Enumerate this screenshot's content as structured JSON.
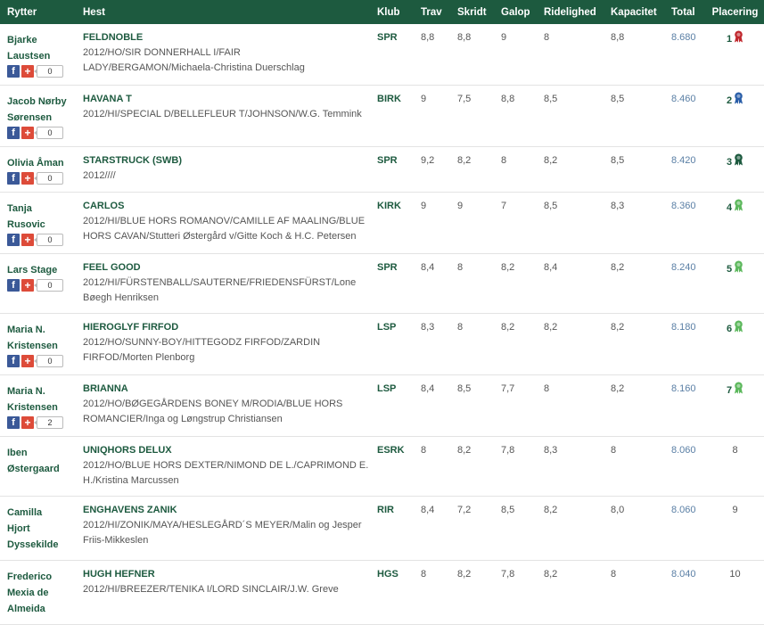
{
  "headers": {
    "rytter": "Rytter",
    "hest": "Hest",
    "klub": "Klub",
    "trav": "Trav",
    "skridt": "Skridt",
    "galop": "Galop",
    "ridelighed": "Ridelighed",
    "kapacitet": "Kapacitet",
    "total": "Total",
    "placering": "Placering"
  },
  "colors": {
    "header_bg": "#1d5a3f",
    "accent_text": "#1d5a3f",
    "total_text": "#5a7fa5",
    "facebook": "#3b5998",
    "google_plus": "#dd4b39",
    "rosette_red": "#c0272d",
    "rosette_blue": "#2a5ea8",
    "rosette_darkgreen": "#1d5a3f",
    "rosette_green": "#5cb85c"
  },
  "share_icons": {
    "facebook": "f",
    "google_plus": "+"
  },
  "rows": [
    {
      "rider_line1": "Bjarke",
      "rider_line2": "Laustsen",
      "rider_line3": "",
      "share_count": "0",
      "horse": "FELDNOBLE",
      "pedigree": "2012/HO/SIR DONNERHALL I/FAIR LADY/BERGAMON/Michaela-Christina Duerschlag",
      "klub": "SPR",
      "trav": "8,8",
      "skridt": "8,8",
      "galop": "9",
      "ridelighed": "8",
      "kapacitet": "8,8",
      "total": "8.680",
      "placering": "1",
      "rosette": "rosette_red"
    },
    {
      "rider_line1": "Jacob Nørby",
      "rider_line2": "Sørensen",
      "rider_line3": "",
      "share_count": "0",
      "horse": "HAVANA T",
      "pedigree": "2012/HI/SPECIAL D/BELLEFLEUR T/JOHNSON/W.G. Temmink",
      "klub": "BIRK",
      "trav": "9",
      "skridt": "7,5",
      "galop": "8,8",
      "ridelighed": "8,5",
      "kapacitet": "8,5",
      "total": "8.460",
      "placering": "2",
      "rosette": "rosette_blue"
    },
    {
      "rider_line1": "Olivia Åman",
      "rider_line2": "",
      "rider_line3": "",
      "share_count": "0",
      "horse": "STARSTRUCK (SWB)",
      "pedigree": "2012////",
      "klub": "SPR",
      "trav": "9,2",
      "skridt": "8,2",
      "galop": "8",
      "ridelighed": "8,2",
      "kapacitet": "8,5",
      "total": "8.420",
      "placering": "3",
      "rosette": "rosette_darkgreen"
    },
    {
      "rider_line1": "Tanja",
      "rider_line2": "Rusovic",
      "rider_line3": "",
      "share_count": "0",
      "horse": "CARLOS",
      "pedigree": "2012/HI/BLUE HORS ROMANOV/CAMILLE AF MAALING/BLUE HORS CAVAN/Stutteri Østergård v/Gitte Koch & H.C. Petersen",
      "klub": "KIRK",
      "trav": "9",
      "skridt": "9",
      "galop": "7",
      "ridelighed": "8,5",
      "kapacitet": "8,3",
      "total": "8.360",
      "placering": "4",
      "rosette": "rosette_green"
    },
    {
      "rider_line1": "Lars Stage",
      "rider_line2": "",
      "rider_line3": "",
      "share_count": "0",
      "horse": "FEEL GOOD",
      "pedigree": "2012/HI/FÜRSTENBALL/SAUTERNE/FRIEDENSFÜRST/Lone Bøegh Henriksen",
      "klub": "SPR",
      "trav": "8,4",
      "skridt": "8",
      "galop": "8,2",
      "ridelighed": "8,4",
      "kapacitet": "8,2",
      "total": "8.240",
      "placering": "5",
      "rosette": "rosette_green"
    },
    {
      "rider_line1": "Maria N.",
      "rider_line2": "Kristensen",
      "rider_line3": "",
      "share_count": "0",
      "horse": "HIEROGLYF FIRFOD",
      "pedigree": "2012/HO/SUNNY-BOY/HITTEGODZ FIRFOD/ZARDIN FIRFOD/Morten Plenborg",
      "klub": "LSP",
      "trav": "8,3",
      "skridt": "8",
      "galop": "8,2",
      "ridelighed": "8,2",
      "kapacitet": "8,2",
      "total": "8.180",
      "placering": "6",
      "rosette": "rosette_green"
    },
    {
      "rider_line1": "Maria N.",
      "rider_line2": "Kristensen",
      "rider_line3": "",
      "share_count": "2",
      "horse": "BRIANNA",
      "pedigree": "2012/HO/BØGEGÅRDENS BONEY M/RODIA/BLUE HORS ROMANCIER/Inga og Løngstrup Christiansen",
      "klub": "LSP",
      "trav": "8,4",
      "skridt": "8,5",
      "galop": "7,7",
      "ridelighed": "8",
      "kapacitet": "8,2",
      "total": "8.160",
      "placering": "7",
      "rosette": "rosette_green"
    },
    {
      "rider_line1": "Iben",
      "rider_line2": "Østergaard",
      "rider_line3": "",
      "share_count": "",
      "horse": "UNIQHORS DELUX",
      "pedigree": "2012/HO/BLUE HORS DEXTER/NIMOND DE L./CAPRIMOND E. H./Kristina Marcussen",
      "klub": "ESRK",
      "trav": "8",
      "skridt": "8,2",
      "galop": "7,8",
      "ridelighed": "8,3",
      "kapacitet": "8",
      "total": "8.060",
      "placering": "8",
      "rosette": ""
    },
    {
      "rider_line1": "Camilla",
      "rider_line2": "Hjort",
      "rider_line3": "Dyssekilde",
      "share_count": "",
      "horse": "ENGHAVENS ZANIK",
      "pedigree": "2012/HI/ZONIK/MAYA/HESLEGÅRD´S MEYER/Malin og Jesper Friis-Mikkeslen",
      "klub": "RIR",
      "trav": "8,4",
      "skridt": "7,2",
      "galop": "8,5",
      "ridelighed": "8,2",
      "kapacitet": "8,0",
      "total": "8.060",
      "placering": "9",
      "rosette": ""
    },
    {
      "rider_line1": "Frederico",
      "rider_line2": "Mexia de",
      "rider_line3": "Almeida",
      "share_count": "",
      "horse": "HUGH HEFNER",
      "pedigree": "2012/HI/BREEZER/TENIKA I/LORD SINCLAIR/J.W. Greve",
      "klub": "HGS",
      "trav": "8",
      "skridt": "8,2",
      "galop": "7,8",
      "ridelighed": "8,2",
      "kapacitet": "8",
      "total": "8.040",
      "placering": "10",
      "rosette": ""
    }
  ]
}
